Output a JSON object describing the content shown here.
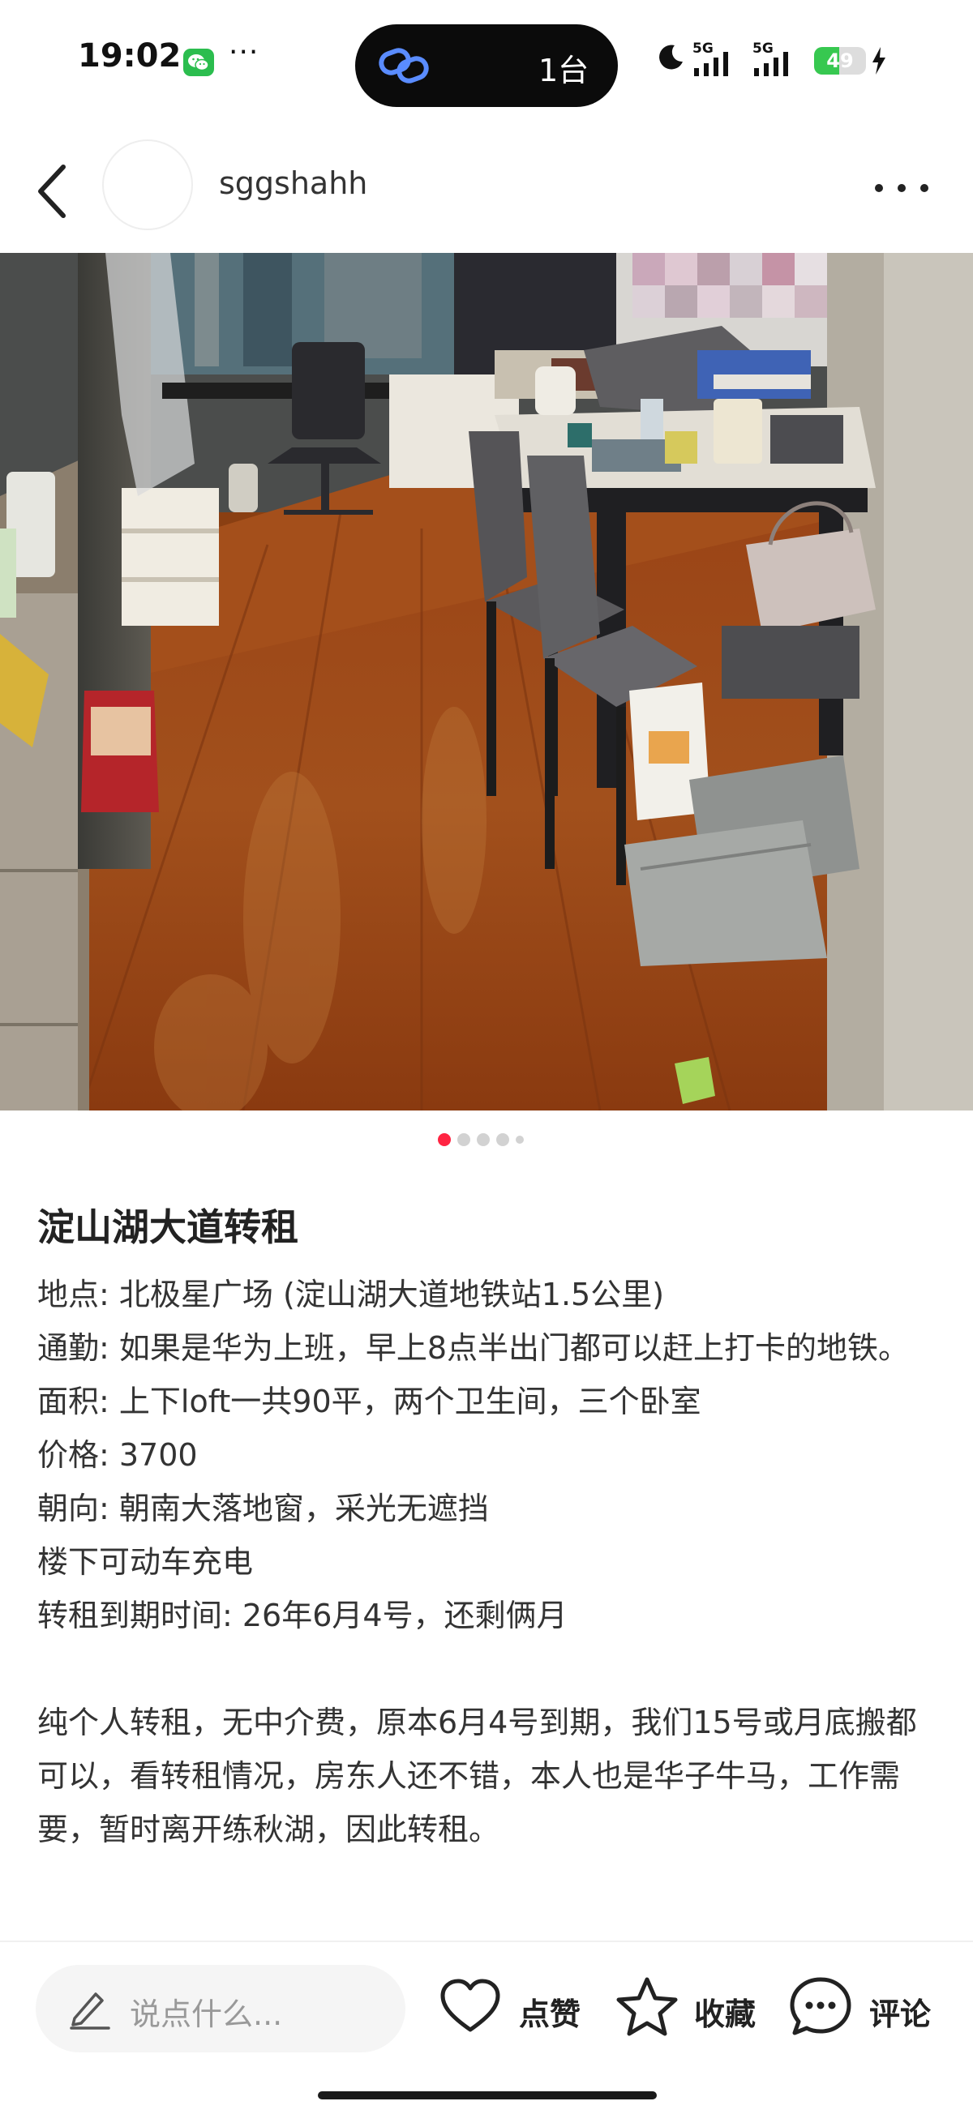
{
  "status_bar": {
    "time": "19:02",
    "more": "···",
    "island_count": "1台",
    "signal_1": "5G",
    "signal_2": "5G",
    "battery": "49",
    "battery_level": 0.49
  },
  "header": {
    "username": "sggshahh"
  },
  "photo": {
    "count": 5,
    "current_index": 0
  },
  "post": {
    "title": "淀山湖大道转租",
    "lines": [
      "地点: 北极星广场 (淀山湖大道地铁站1.5公里)",
      "通勤: 如果是华为上班，早上8点半出门都可以赶上打卡的地铁。",
      "面积: 上下loft一共90平，两个卫生间，三个卧室",
      "价格: 3700",
      "朝向: 朝南大落地窗，采光无遮挡",
      "楼下可动车充电",
      "转租到期时间: 26年6月4号，还剩俩月"
    ],
    "paragraph": "纯个人转租，无中介费，原本6月4号到期，我们15号或月底搬都可以，看转租情况，房东人还不错，本人也是华子牛马，工作需要，暂时离开练秋湖，因此转租。"
  },
  "bottom_bar": {
    "comment_placeholder": "说点什么...",
    "like_label": "点赞",
    "collect_label": "收藏",
    "comment_label": "评论"
  },
  "colors": {
    "accent": "#ff2442",
    "wechat": "#2bbd4e",
    "battery": "#37c850"
  }
}
